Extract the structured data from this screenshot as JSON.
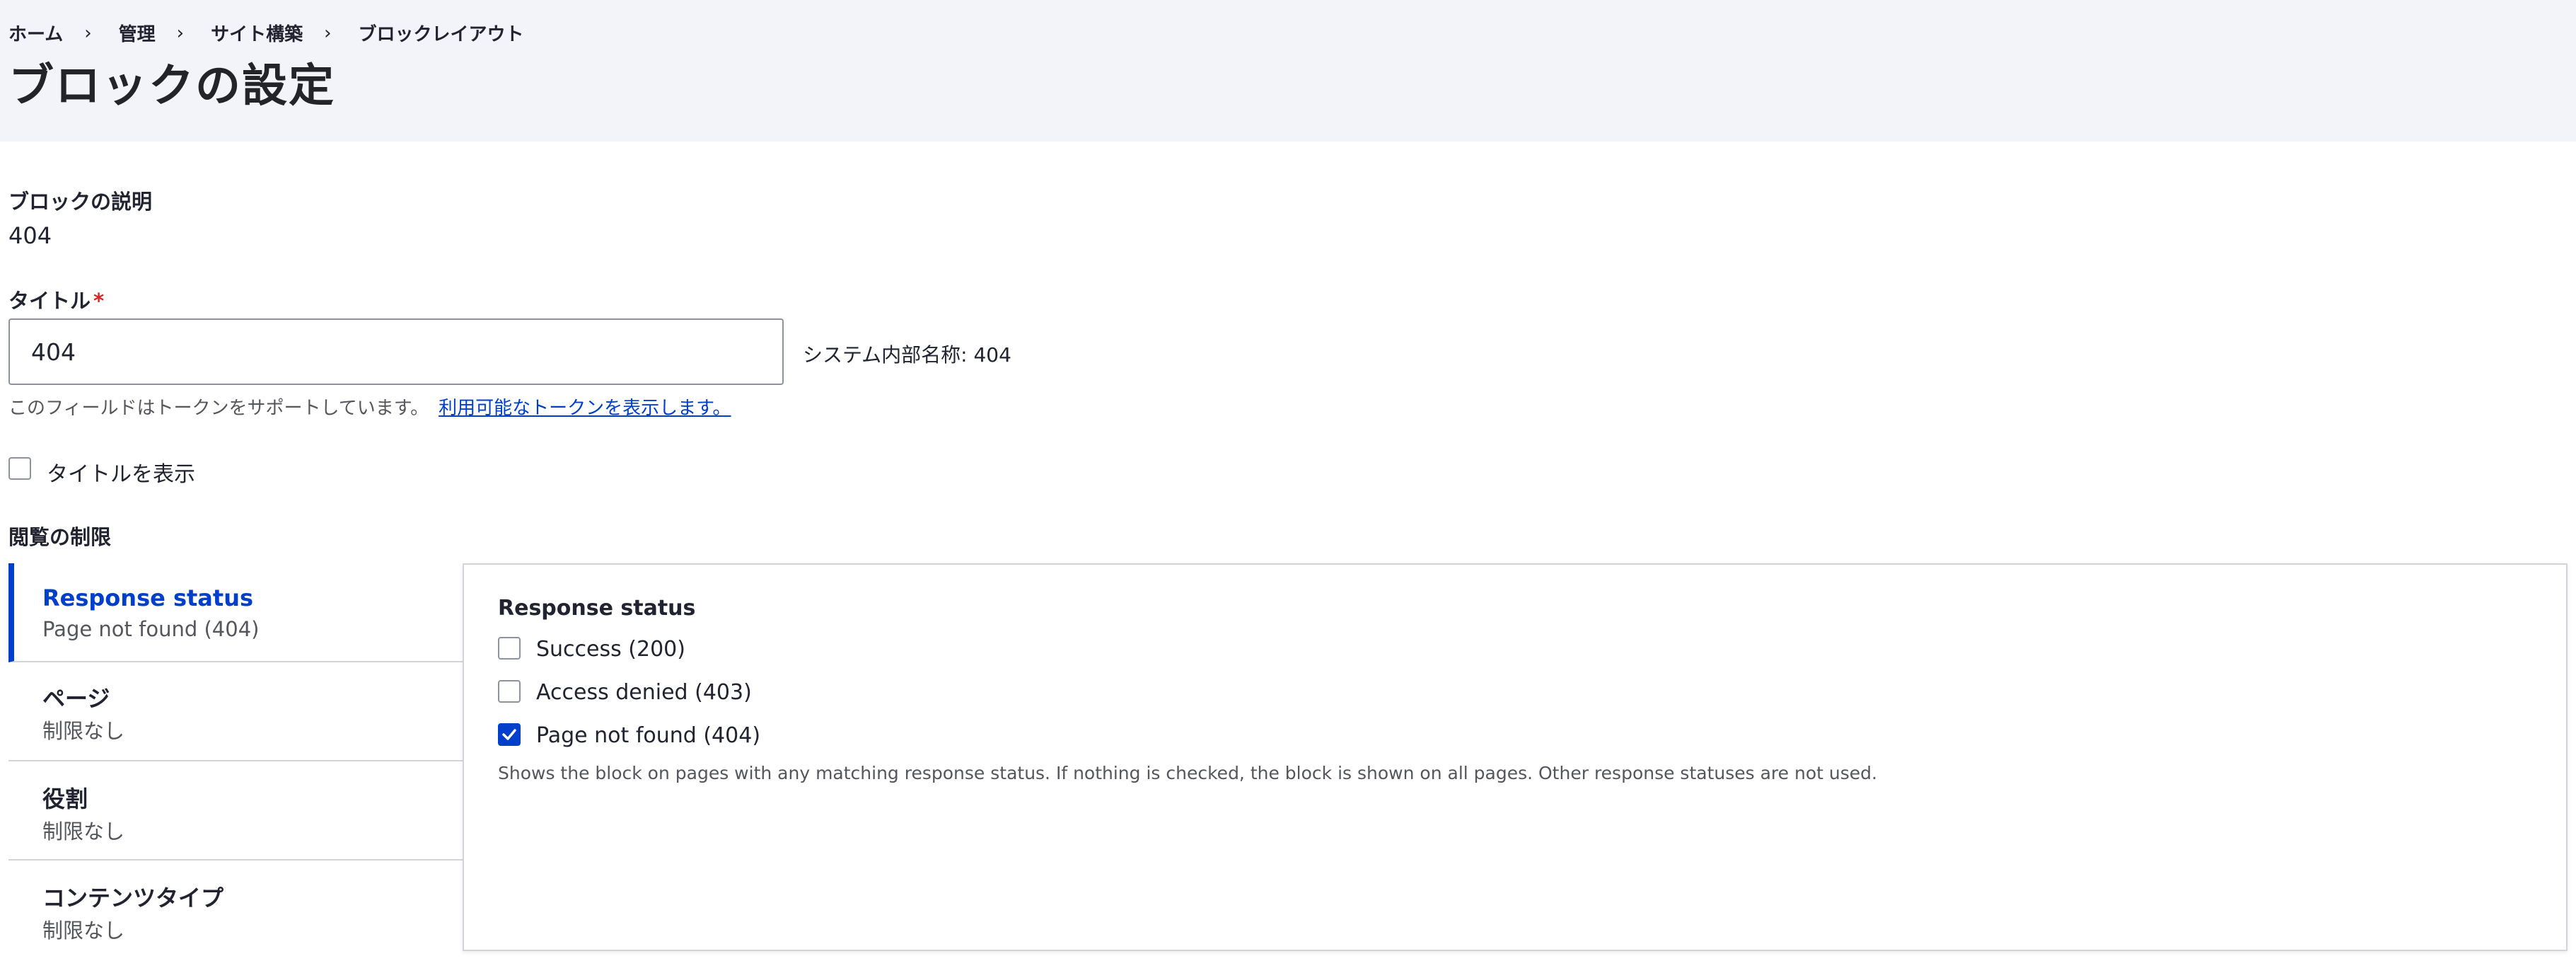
{
  "breadcrumb": {
    "items": [
      "ホーム",
      "管理",
      "サイト構築",
      "ブロックレイアウト"
    ],
    "separator": "›"
  },
  "page_title": "ブロックの設定",
  "block_description": {
    "label": "ブロックの説明",
    "value": "404"
  },
  "title_field": {
    "label": "タイトル",
    "required_marker": "*",
    "value": "404",
    "machine_name": "システム内部名称: 404",
    "description": "このフィールドはトークンをサポートしています。",
    "token_link": "利用可能なトークンを表示します。"
  },
  "display_title": {
    "label": "タイトルを表示",
    "checked": false
  },
  "visibility": {
    "label": "閲覧の制限",
    "tabs": [
      {
        "title": "Response status",
        "summary": "Page not found (404)",
        "active": true
      },
      {
        "title": "ページ",
        "summary": "制限なし",
        "active": false
      },
      {
        "title": "役割",
        "summary": "制限なし",
        "active": false
      },
      {
        "title": "コンテンツタイプ",
        "summary": "制限なし",
        "active": false
      }
    ],
    "pane": {
      "title": "Response status",
      "options": [
        {
          "label": "Success (200)",
          "checked": false
        },
        {
          "label": "Access denied (403)",
          "checked": false
        },
        {
          "label": "Page not found (404)",
          "checked": true
        }
      ],
      "description": "Shows the block on pages with any matching response status. If nothing is checked, the block is shown on all pages. Other response statuses are not used."
    }
  },
  "colors": {
    "accent": "#003ecc",
    "required": "#dc2323",
    "header_bg": "#f3f4f9"
  }
}
